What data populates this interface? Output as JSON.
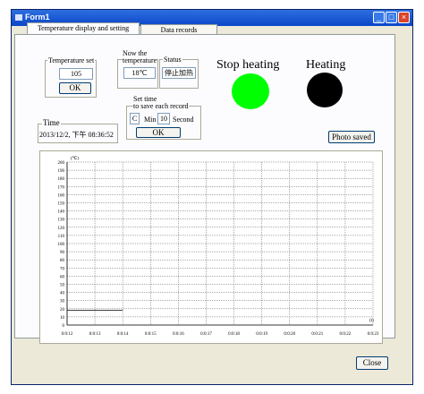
{
  "window": {
    "title": "Form1"
  },
  "tabs": [
    {
      "label": "Temperature display and setting"
    },
    {
      "label": "Data records"
    }
  ],
  "temperature_set": {
    "legend": "Temperature set",
    "value": "105",
    "ok_label": "OK"
  },
  "now_temperature": {
    "legend_line1": "Now the",
    "legend_line2": "temperature",
    "value": "18℃"
  },
  "status": {
    "legend": "Status",
    "value": "停止加热"
  },
  "save_interval": {
    "legend_line1": "Set time",
    "legend_line2": "to save each record",
    "min_value": "C",
    "min_label": "Min",
    "sec_value": "10",
    "sec_label": "Second",
    "ok_label": "OK"
  },
  "time": {
    "legend": "Time",
    "value": "2013/12/2, 下午 08:36:52"
  },
  "indicators": [
    {
      "label": "Stop heating",
      "color": "#00ff00"
    },
    {
      "label": "Heating",
      "color": "#000000"
    }
  ],
  "photo_button": {
    "label": "Photo saved"
  },
  "close_button": {
    "label": "Close"
  },
  "chart_data": {
    "type": "line",
    "ylabel": "(℃)",
    "xlabel": "(t)",
    "ylim": [
      0,
      200
    ],
    "yticks": [
      "200",
      "190",
      "180",
      "170",
      "160",
      "150",
      "140",
      "130",
      "120",
      "110",
      "100",
      "90",
      "80",
      "70",
      "60",
      "50",
      "40",
      "30",
      "20",
      "10",
      "0"
    ],
    "xticks": [
      "0:0:12",
      "0:0:13",
      "0:0:14",
      "0:0:15",
      "0:0:16",
      "0:0:17",
      "0:0:18",
      "0:0:19",
      "0:0:20",
      "0:0:21",
      "0:0:22",
      "0:0:23"
    ],
    "grid": true,
    "series": [
      {
        "x": [
          "0:0:12",
          "0:0:14"
        ],
        "values": [
          18,
          18
        ]
      }
    ]
  }
}
